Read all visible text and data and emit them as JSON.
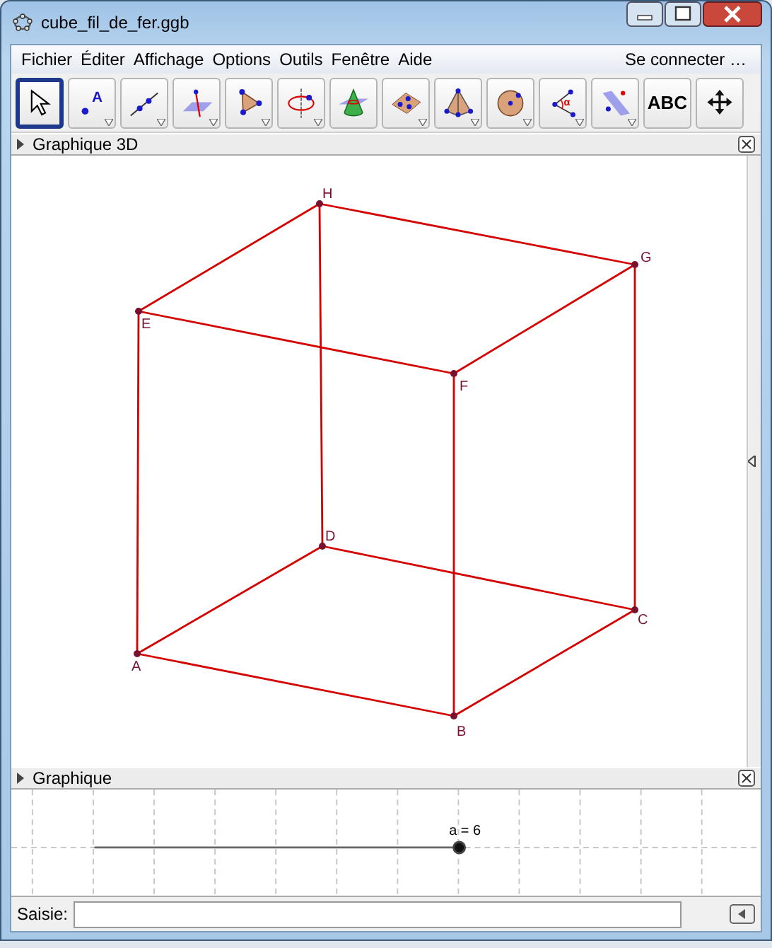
{
  "window": {
    "title": "cube_fil_de_fer.ggb"
  },
  "menu": [
    {
      "label": "Fichier"
    },
    {
      "label": "Éditer"
    },
    {
      "label": "Affichage"
    },
    {
      "label": "Options"
    },
    {
      "label": "Outils"
    },
    {
      "label": "Fenêtre"
    },
    {
      "label": "Aide"
    }
  ],
  "login": "Se connecter …",
  "toolbar": [
    {
      "kind": "icon",
      "selected": true,
      "has_menu": false
    },
    {
      "kind": "icon",
      "glyph": "A",
      "selected": false,
      "has_menu": true
    },
    {
      "kind": "icon",
      "selected": false,
      "has_menu": true
    },
    {
      "kind": "icon",
      "selected": false,
      "has_menu": true
    },
    {
      "kind": "icon",
      "selected": false,
      "has_menu": true
    },
    {
      "kind": "icon",
      "selected": false,
      "has_menu": true
    },
    {
      "kind": "icon",
      "selected": false,
      "has_menu": false
    },
    {
      "kind": "icon",
      "selected": false,
      "has_menu": true
    },
    {
      "kind": "icon",
      "selected": false,
      "has_menu": true
    },
    {
      "kind": "icon",
      "selected": false,
      "has_menu": true
    },
    {
      "kind": "icon",
      "glyph": "α",
      "selected": false,
      "has_menu": true
    },
    {
      "kind": "icon",
      "selected": false,
      "has_menu": true
    },
    {
      "kind": "text",
      "label": "ABC",
      "selected": false,
      "has_menu": false
    },
    {
      "kind": "icon",
      "selected": false,
      "has_menu": false
    }
  ],
  "view3d": {
    "title": "Graphique 3D",
    "points": [
      {
        "label": "H"
      },
      {
        "label": "G"
      },
      {
        "label": "E"
      },
      {
        "label": "F"
      },
      {
        "label": "D"
      },
      {
        "label": "C"
      },
      {
        "label": "A"
      },
      {
        "label": "B"
      }
    ]
  },
  "view2d": {
    "title": "Graphique",
    "slider": {
      "label": "a = 6",
      "level": 1
    }
  },
  "input_bar": {
    "label": "Saisie:"
  }
}
